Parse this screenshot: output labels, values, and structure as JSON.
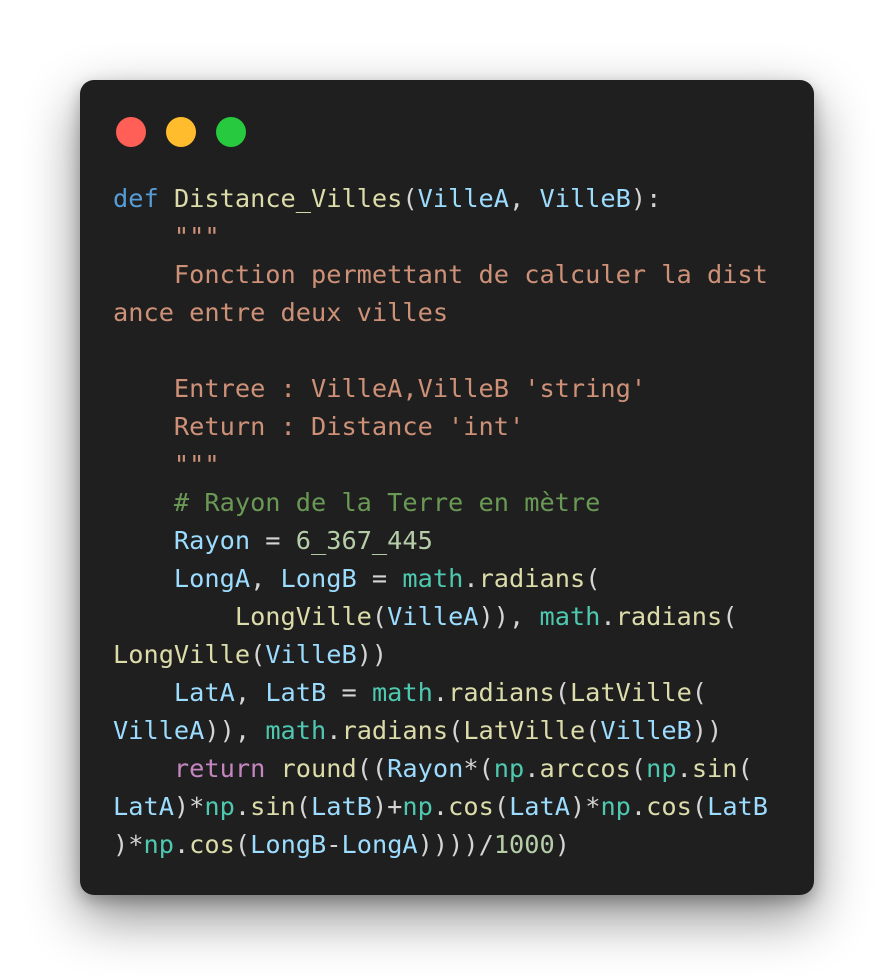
{
  "window": {
    "buttons": [
      {
        "name": "close-dot",
        "color": "#ff5f56"
      },
      {
        "name": "minimize-dot",
        "color": "#ffbd2e"
      },
      {
        "name": "maximize-dot",
        "color": "#27c93f"
      }
    ]
  },
  "code": {
    "language": "python",
    "colors": {
      "keyword": "#569cd6",
      "function": "#dcdcaa",
      "variable": "#9cdcfe",
      "string": "#ce9178",
      "comment": "#6a9955",
      "number": "#b5cea8",
      "module": "#4ec9b0",
      "control": "#c586c0",
      "plain": "#d4d4d4"
    },
    "lines": [
      [
        [
          "kw",
          "def"
        ],
        [
          "plain",
          " "
        ],
        [
          "fn",
          "Distance_Villes"
        ],
        [
          "plain",
          "("
        ],
        [
          "var",
          "VilleA"
        ],
        [
          "plain",
          ", "
        ],
        [
          "var",
          "VilleB"
        ],
        [
          "plain",
          "):"
        ]
      ],
      [
        [
          "plain",
          "    "
        ],
        [
          "str",
          "\"\"\""
        ]
      ],
      [
        [
          "plain",
          "    "
        ],
        [
          "str",
          "Fonction permettant de calculer la dist"
        ]
      ],
      [
        [
          "str",
          "ance entre deux villes"
        ]
      ],
      [],
      [
        [
          "plain",
          "    "
        ],
        [
          "str",
          "Entree : VilleA,VilleB 'string'"
        ]
      ],
      [
        [
          "plain",
          "    "
        ],
        [
          "str",
          "Return : Distance 'int'"
        ]
      ],
      [
        [
          "plain",
          "    "
        ],
        [
          "str",
          "\"\"\""
        ]
      ],
      [
        [
          "plain",
          "    "
        ],
        [
          "cm",
          "# Rayon de la Terre en mètre"
        ]
      ],
      [
        [
          "plain",
          "    "
        ],
        [
          "var",
          "Rayon"
        ],
        [
          "plain",
          " = "
        ],
        [
          "num",
          "6_367_445"
        ]
      ],
      [
        [
          "plain",
          "    "
        ],
        [
          "var",
          "LongA"
        ],
        [
          "plain",
          ", "
        ],
        [
          "var",
          "LongB"
        ],
        [
          "plain",
          " = "
        ],
        [
          "mod",
          "math"
        ],
        [
          "plain",
          "."
        ],
        [
          "fn",
          "radians"
        ],
        [
          "plain",
          "("
        ]
      ],
      [
        [
          "plain",
          "        "
        ],
        [
          "fn",
          "LongVille"
        ],
        [
          "plain",
          "("
        ],
        [
          "var",
          "VilleA"
        ],
        [
          "plain",
          ")), "
        ],
        [
          "mod",
          "math"
        ],
        [
          "plain",
          "."
        ],
        [
          "fn",
          "radians"
        ],
        [
          "plain",
          "("
        ]
      ],
      [
        [
          "fn",
          "LongVille"
        ],
        [
          "plain",
          "("
        ],
        [
          "var",
          "VilleB"
        ],
        [
          "plain",
          "))"
        ]
      ],
      [
        [
          "plain",
          "    "
        ],
        [
          "var",
          "LatA"
        ],
        [
          "plain",
          ", "
        ],
        [
          "var",
          "LatB"
        ],
        [
          "plain",
          " = "
        ],
        [
          "mod",
          "math"
        ],
        [
          "plain",
          "."
        ],
        [
          "fn",
          "radians"
        ],
        [
          "plain",
          "("
        ],
        [
          "fn",
          "LatVille"
        ],
        [
          "plain",
          "("
        ]
      ],
      [
        [
          "var",
          "VilleA"
        ],
        [
          "plain",
          ")), "
        ],
        [
          "mod",
          "math"
        ],
        [
          "plain",
          "."
        ],
        [
          "fn",
          "radians"
        ],
        [
          "plain",
          "("
        ],
        [
          "fn",
          "LatVille"
        ],
        [
          "plain",
          "("
        ],
        [
          "var",
          "VilleB"
        ],
        [
          "plain",
          "))"
        ]
      ],
      [
        [
          "plain",
          "    "
        ],
        [
          "ctl",
          "return"
        ],
        [
          "plain",
          " "
        ],
        [
          "fn",
          "round"
        ],
        [
          "plain",
          "(("
        ],
        [
          "var",
          "Rayon"
        ],
        [
          "plain",
          "*("
        ],
        [
          "mod",
          "np"
        ],
        [
          "plain",
          "."
        ],
        [
          "fn",
          "arccos"
        ],
        [
          "plain",
          "("
        ],
        [
          "mod",
          "np"
        ],
        [
          "plain",
          "."
        ],
        [
          "fn",
          "sin"
        ],
        [
          "plain",
          "("
        ]
      ],
      [
        [
          "var",
          "LatA"
        ],
        [
          "plain",
          ")*"
        ],
        [
          "mod",
          "np"
        ],
        [
          "plain",
          "."
        ],
        [
          "fn",
          "sin"
        ],
        [
          "plain",
          "("
        ],
        [
          "var",
          "LatB"
        ],
        [
          "plain",
          ")+"
        ],
        [
          "mod",
          "np"
        ],
        [
          "plain",
          "."
        ],
        [
          "fn",
          "cos"
        ],
        [
          "plain",
          "("
        ],
        [
          "var",
          "LatA"
        ],
        [
          "plain",
          ")*"
        ],
        [
          "mod",
          "np"
        ],
        [
          "plain",
          "."
        ],
        [
          "fn",
          "cos"
        ],
        [
          "plain",
          "("
        ],
        [
          "var",
          "LatB"
        ]
      ],
      [
        [
          "plain",
          ")*"
        ],
        [
          "mod",
          "np"
        ],
        [
          "plain",
          "."
        ],
        [
          "fn",
          "cos"
        ],
        [
          "plain",
          "("
        ],
        [
          "var",
          "LongB"
        ],
        [
          "plain",
          "-"
        ],
        [
          "var",
          "LongA"
        ],
        [
          "plain",
          "))))/"
        ],
        [
          "num",
          "1000"
        ],
        [
          "plain",
          ")"
        ]
      ]
    ]
  }
}
